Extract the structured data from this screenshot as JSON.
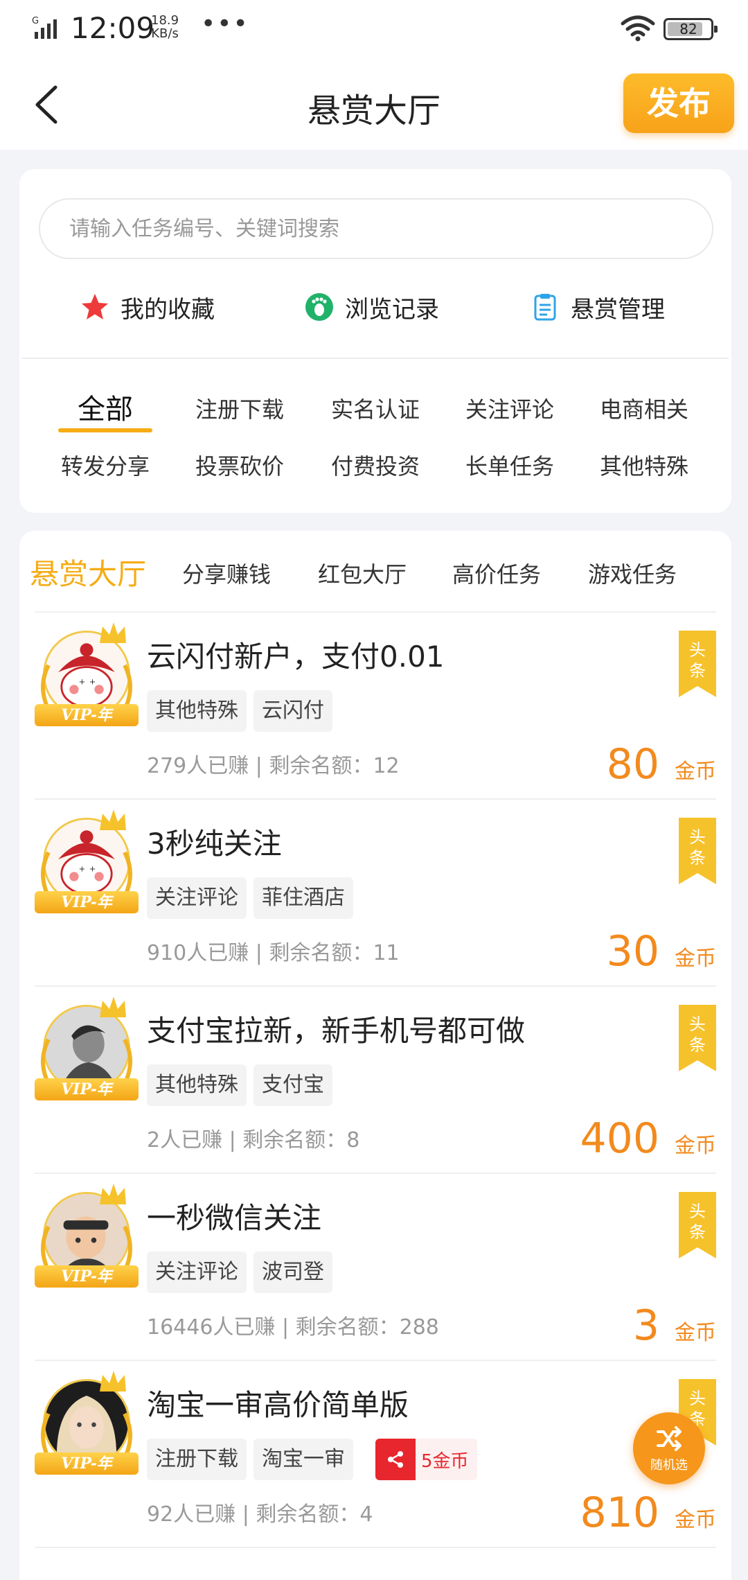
{
  "status_bar": {
    "time": "12:09",
    "speed_value": "18.9",
    "speed_unit": "KB/s",
    "more": "•••",
    "battery": "82"
  },
  "header": {
    "title": "悬赏大厅",
    "publish_label": "发布"
  },
  "search": {
    "placeholder": "请输入任务编号、关键词搜索"
  },
  "quick_links": [
    {
      "label": "我的收藏",
      "icon": "star-icon"
    },
    {
      "label": "浏览记录",
      "icon": "footprint-icon"
    },
    {
      "label": "悬赏管理",
      "icon": "clipboard-icon"
    }
  ],
  "categories": [
    "全部",
    "注册下载",
    "实名认证",
    "关注评论",
    "电商相关",
    "转发分享",
    "投票砍价",
    "付费投资",
    "长单任务",
    "其他特殊"
  ],
  "selected_category": "全部",
  "tabs": [
    "悬赏大厅",
    "分享赚钱",
    "红包大厅",
    "高价任务",
    "游戏任务"
  ],
  "active_tab": "悬赏大厅",
  "vip_label": "VIP-年",
  "headline_badge": "头条",
  "coin_unit": "金币",
  "tasks": [
    {
      "title": "云闪付新户，支付0.01",
      "tags": [
        "其他特殊",
        "云闪付"
      ],
      "meta": "279人已赚 | 剩余名额：12",
      "price": "80",
      "avatar": "mascot"
    },
    {
      "title": "3秒纯关注",
      "tags": [
        "关注评论",
        "菲住酒店"
      ],
      "meta": "910人已赚 | 剩余名额：11",
      "price": "30",
      "avatar": "mascot"
    },
    {
      "title": "支付宝拉新，新手机号都可做",
      "tags": [
        "其他特殊",
        "支付宝"
      ],
      "meta": "2人已赚 | 剩余名额：8",
      "price": "400",
      "avatar": "person-gray"
    },
    {
      "title": "一秒微信关注",
      "tags": [
        "关注评论",
        "波司登"
      ],
      "meta": "16446人已赚 | 剩余名额：288",
      "price": "3",
      "avatar": "child"
    },
    {
      "title": "淘宝一审高价简单版",
      "tags": [
        "注册下载",
        "淘宝一审"
      ],
      "share_reward": "5金币",
      "meta": "92人已赚 | 剩余名额：4",
      "price": "810",
      "avatar": "person-blonde"
    }
  ],
  "fab": {
    "label": "随机选"
  },
  "colors": {
    "accent": "#f6ac15",
    "price": "#f28a1d",
    "share": "#e8262d",
    "background": "#f3f4f8"
  }
}
